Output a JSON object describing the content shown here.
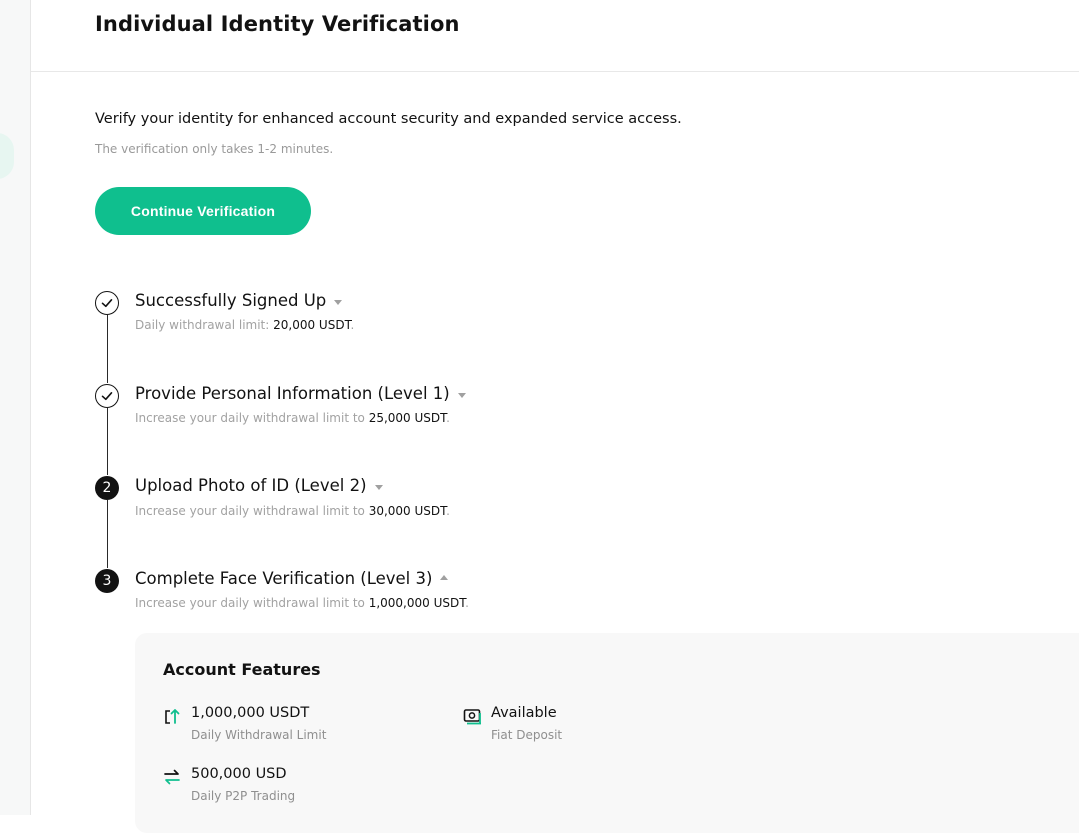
{
  "header": {
    "title": "Individual Identity Verification"
  },
  "intro": {
    "headline": "Verify your identity for enhanced account security and expanded service access.",
    "note": "The verification only takes 1-2 minutes.",
    "button_label": "Continue Verification"
  },
  "colors": {
    "accent": "#0fbf8e",
    "text": "#121212",
    "muted": "#a2a2a2"
  },
  "steps": [
    {
      "status": "done",
      "icon": "check-circle-icon",
      "title": "Successfully Signed Up",
      "caret": "down",
      "desc_prefix": "Daily withdrawal limit: ",
      "amount": "20,000 USDT",
      "desc_suffix": "."
    },
    {
      "status": "done",
      "icon": "check-circle-icon",
      "title": "Provide Personal Information (Level 1)",
      "caret": "down",
      "desc_prefix": "Increase your daily withdrawal limit to ",
      "amount": "25,000 USDT",
      "desc_suffix": "."
    },
    {
      "status": "pending",
      "number": "2",
      "title": "Upload Photo of ID (Level 2)",
      "caret": "down",
      "desc_prefix": "Increase your daily withdrawal limit to ",
      "amount": "30,000 USDT",
      "desc_suffix": "."
    },
    {
      "status": "pending",
      "number": "3",
      "title": "Complete Face Verification (Level 3)",
      "caret": "up",
      "desc_prefix": "Increase your daily withdrawal limit to ",
      "amount": "1,000,000 USDT",
      "desc_suffix": "."
    }
  ],
  "features": {
    "title": "Account Features",
    "items": [
      {
        "icon": "withdraw-arrow-icon",
        "value": "1,000,000 USDT",
        "label": "Daily Withdrawal Limit"
      },
      {
        "icon": "cash-deposit-icon",
        "value": "Available",
        "label": "Fiat Deposit"
      },
      {
        "icon": "swap-arrows-icon",
        "value": "500,000 USD",
        "label": "Daily P2P Trading"
      }
    ]
  }
}
